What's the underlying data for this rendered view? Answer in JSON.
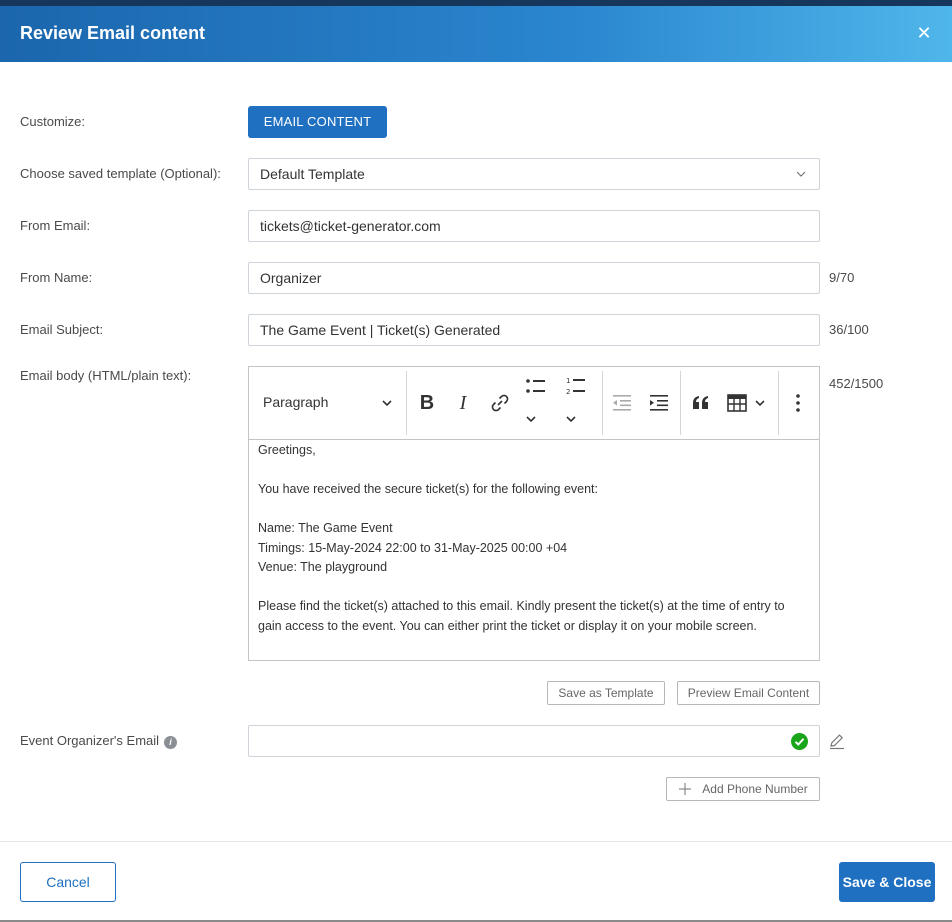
{
  "dialog": {
    "title": "Review Email content"
  },
  "customize": {
    "label": "Customize:",
    "button": "EMAIL CONTENT"
  },
  "template": {
    "label": "Choose saved template (Optional):",
    "value": "Default Template"
  },
  "from_email": {
    "label": "From Email:",
    "value": "tickets@ticket-generator.com"
  },
  "from_name": {
    "label": "From Name:",
    "value": "Organizer",
    "counter": "9/70"
  },
  "subject": {
    "label": "Email Subject:",
    "value": "The Game Event | Ticket(s) Generated",
    "counter": "36/100"
  },
  "body": {
    "label": "Email body (HTML/plain text):",
    "counter": "452/1500",
    "block_format": "Paragraph",
    "lines": [
      "Greetings,",
      "",
      "You have received the secure ticket(s) for the following event:",
      "",
      "Name: The Game Event",
      "Timings: 15-May-2024 22:00 to 31-May-2025 00:00 +04",
      "Venue: The playground",
      "",
      "Please find the ticket(s) attached to this email. Kindly present the ticket(s) at the time of entry to gain access to the event. You can either print the ticket or display it on your mobile screen."
    ]
  },
  "actions": {
    "save_template": "Save as Template",
    "preview": "Preview Email Content"
  },
  "organizer": {
    "label": "Event Organizer's Email",
    "value": "",
    "add_phone": "Add Phone Number"
  },
  "footer": {
    "cancel": "Cancel",
    "save": "Save & Close"
  },
  "colors": {
    "primary": "#1f70c1",
    "success": "#1aa51a",
    "header_start": "#1b66ad",
    "header_end": "#4fb6ea"
  }
}
